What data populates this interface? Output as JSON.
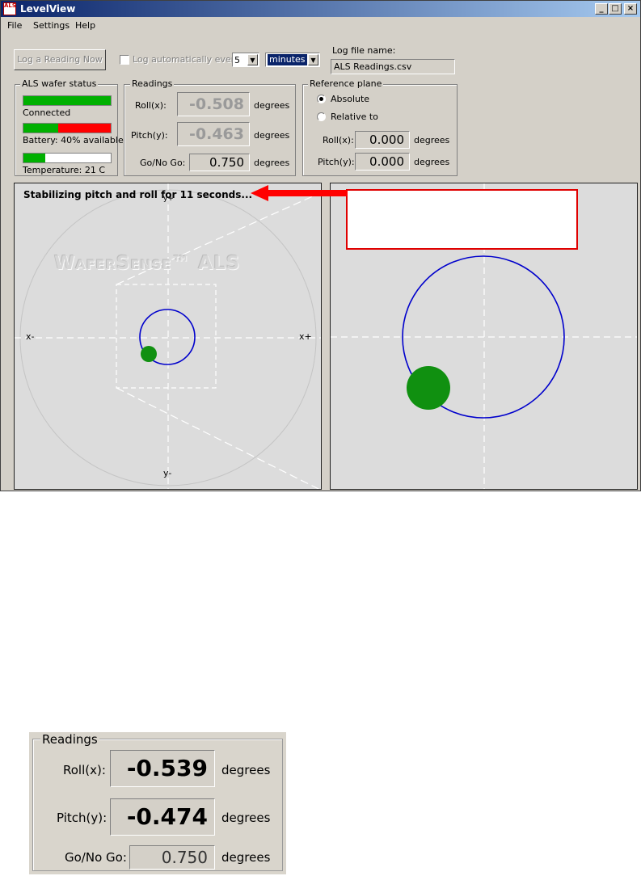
{
  "window": {
    "title": "LevelView",
    "icon_text": "ALS",
    "controls": [
      "_",
      "□",
      "×"
    ]
  },
  "menu": [
    "File",
    "Settings",
    "Help"
  ],
  "toolbar": {
    "log_button": "Log a Reading Now",
    "auto_log_label": "Log automatically every",
    "interval_value": "5",
    "interval_unit": "minutes",
    "log_file_label": "Log file name:",
    "log_file_value": "ALS Readings.csv"
  },
  "status_group": {
    "title": "ALS wafer status",
    "connected_label": "Connected",
    "battery_label": "Battery: 40% available",
    "battery_percent": 40,
    "temperature_label": "Temperature: 21 C",
    "temperature_fill": 0.25
  },
  "readings": {
    "title": "Readings",
    "roll_label": "Roll(x):",
    "roll_value": "-0.508",
    "pitch_label": "Pitch(y):",
    "pitch_value": "-0.463",
    "gonogo_label": "Go/No Go:",
    "gonogo_value": "0.750",
    "unit": "degrees"
  },
  "reference": {
    "title": "Reference plane",
    "absolute_label": "Absolute",
    "relative_label": "Relative to",
    "roll_label": "Roll(x):",
    "roll_value": "0.000",
    "pitch_label": "Pitch(y):",
    "pitch_value": "0.000",
    "unit": "degrees"
  },
  "plot": {
    "status_message": "Stabilizing pitch and roll for 11 seconds...",
    "watermark": "WaferSense™ ALS",
    "x_minus": "x-",
    "x_plus": "x+",
    "y_minus": "y-",
    "y_plus": "y+"
  },
  "colors": {
    "target_ring": "#0000cc",
    "bubble": "#109010",
    "callout": "#ff0000"
  },
  "zoom": {
    "title": "Readings",
    "roll_label": "Roll(x):",
    "roll_value": "-0.539",
    "pitch_label": "Pitch(y):",
    "pitch_value": "-0.474",
    "gonogo_label": "Go/No Go:",
    "gonogo_value": "0.750",
    "unit": "degrees"
  }
}
